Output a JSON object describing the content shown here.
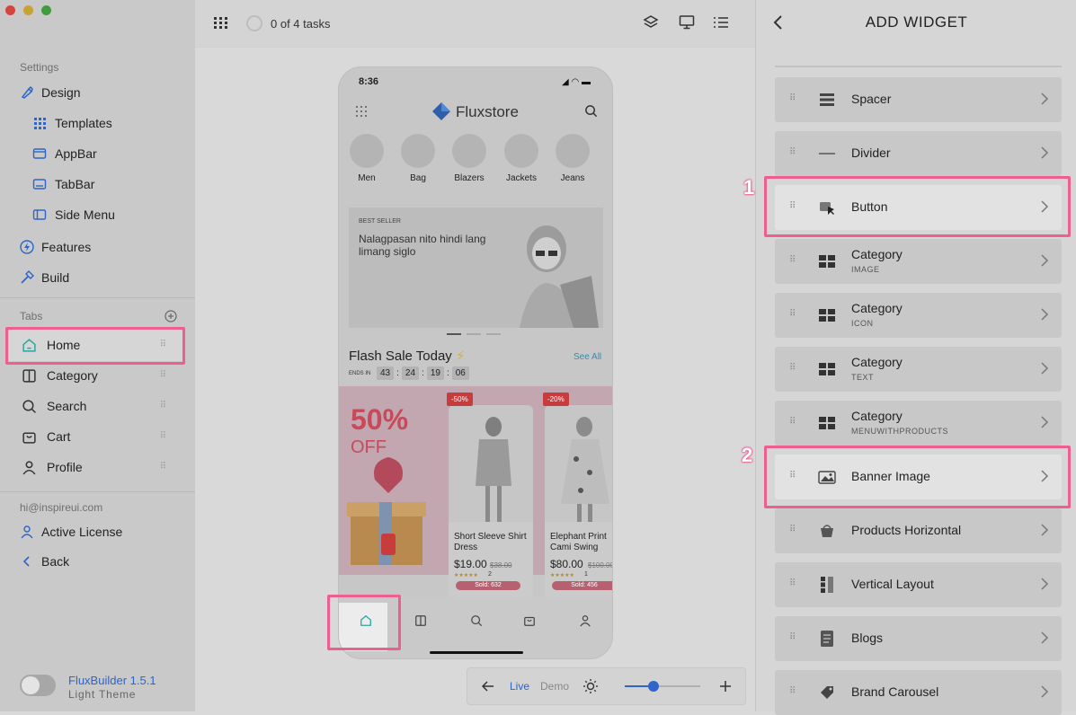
{
  "sidebar": {
    "settings_label": "Settings",
    "design": "Design",
    "templates": "Templates",
    "appbar": "AppBar",
    "tabbar": "TabBar",
    "sidemenu": "Side Menu",
    "features": "Features",
    "build": "Build",
    "tabs_label": "Tabs",
    "tabs": [
      "Home",
      "Category",
      "Search",
      "Cart",
      "Profile"
    ],
    "email": "hi@inspireui.com",
    "active_license": "Active License",
    "back": "Back",
    "app_version": "FluxBuilder 1.5.1",
    "theme_label": "Light Theme"
  },
  "topbar": {
    "tasks": "0 of 4 tasks"
  },
  "phone": {
    "time": "8:36",
    "brand": "Fluxstore",
    "categories": [
      "Men",
      "Bag",
      "Blazers",
      "Jackets",
      "Jeans"
    ],
    "banner_tag": "BEST SELLER",
    "banner_text": "Nalagpasan nito hindi lang limang siglo",
    "flash_title": "Flash Sale Today",
    "see_all": "See All",
    "ends_in": "ENDS IN",
    "timer": [
      "43",
      "24",
      "19",
      "06"
    ],
    "promo_big": "50%",
    "promo_off": "OFF",
    "products": [
      {
        "badge": "-50%",
        "name": "Short Sleeve Shirt Dress",
        "price": "$19.00",
        "old": "$38.00",
        "reviews": "2",
        "sold": "Sold: 632"
      },
      {
        "badge": "-20%",
        "name": "Elephant Print Cami Swing",
        "price": "$80.00",
        "old": "$100.00",
        "reviews": "1",
        "sold": "Sold: 456"
      }
    ]
  },
  "bottombar": {
    "live": "Live",
    "demo": "Demo",
    "zoom_fraction": 0.38
  },
  "panel": {
    "title": "ADD WIDGET",
    "widgets": [
      {
        "label": "Spacer",
        "sub": ""
      },
      {
        "label": "Divider",
        "sub": ""
      },
      {
        "label": "Button",
        "sub": ""
      },
      {
        "label": "Category",
        "sub": "IMAGE"
      },
      {
        "label": "Category",
        "sub": "ICON"
      },
      {
        "label": "Category",
        "sub": "TEXT"
      },
      {
        "label": "Category",
        "sub": "MENUWITHPRODUCTS"
      },
      {
        "label": "Banner Image",
        "sub": ""
      },
      {
        "label": "Products Horizontal",
        "sub": ""
      },
      {
        "label": "Vertical Layout",
        "sub": ""
      },
      {
        "label": "Blogs",
        "sub": ""
      },
      {
        "label": "Brand Carousel",
        "sub": ""
      }
    ],
    "step_labels": [
      "1",
      "2"
    ]
  },
  "colors": {
    "highlight": "#ef5f8e",
    "accent": "#2f64c8",
    "sale_red": "#c83c3c"
  }
}
